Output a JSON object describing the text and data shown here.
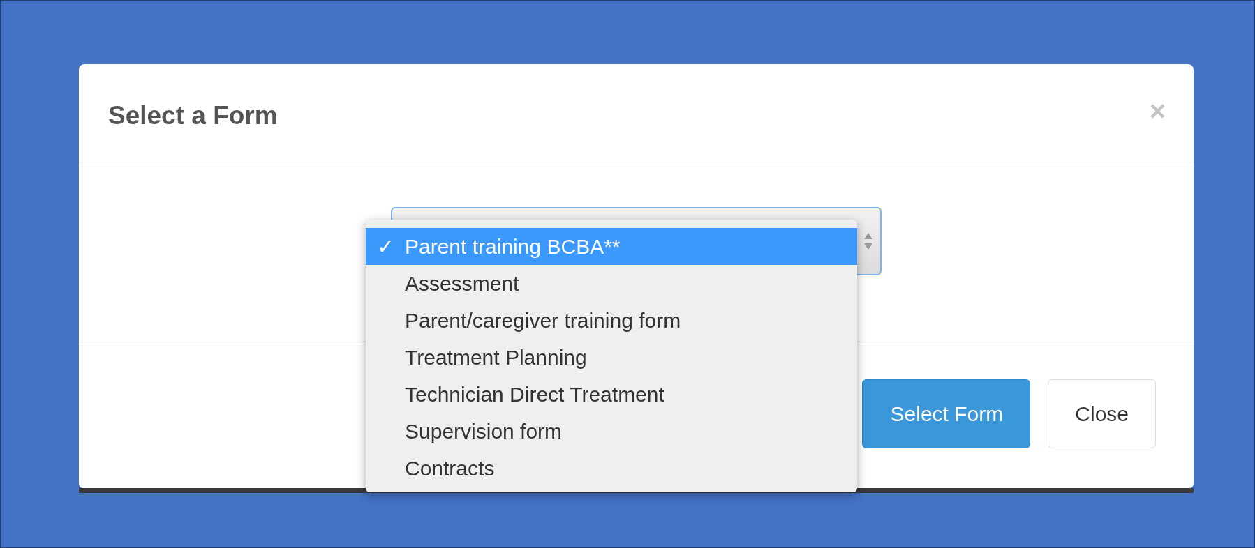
{
  "dialog": {
    "title": "Select a Form",
    "close": "×"
  },
  "form_select": {
    "check_mark": "✓",
    "options": [
      {
        "label": "Parent training BCBA**",
        "selected": true
      },
      {
        "label": "Assessment",
        "selected": false
      },
      {
        "label": "Parent/caregiver training form",
        "selected": false
      },
      {
        "label": "Treatment Planning",
        "selected": false
      },
      {
        "label": "Technician Direct Treatment",
        "selected": false
      },
      {
        "label": "Supervision form",
        "selected": false
      },
      {
        "label": "Contracts",
        "selected": false
      }
    ]
  },
  "buttons": [
    {
      "label": "Select Form",
      "kind": "primary"
    },
    {
      "label": "Close",
      "kind": "default"
    }
  ]
}
